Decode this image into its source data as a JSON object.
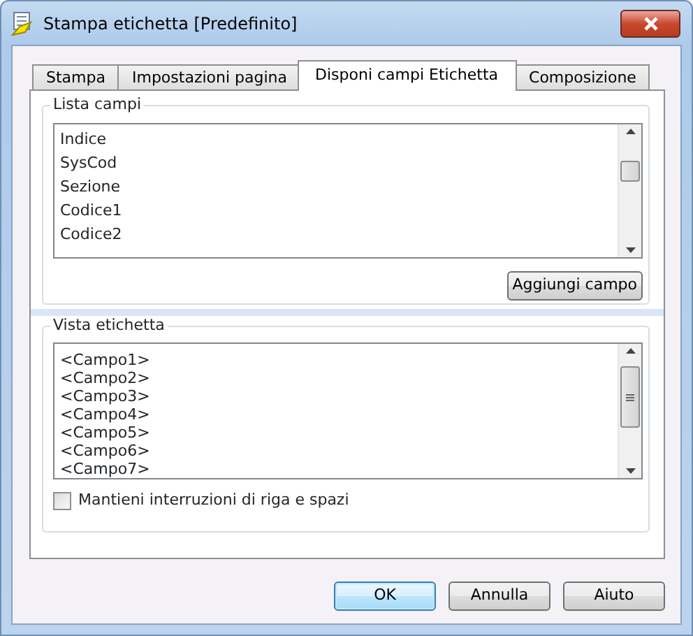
{
  "window": {
    "title": "Stampa etichetta [Predefinito]"
  },
  "tabs": [
    {
      "label": "Stampa",
      "selected": false
    },
    {
      "label": "Impostazioni pagina",
      "selected": false
    },
    {
      "label": "Disponi campi Etichetta",
      "selected": true
    },
    {
      "label": "Composizione",
      "selected": false
    }
  ],
  "field_list": {
    "title": "Lista campi",
    "items": [
      "Indice",
      "SysCod",
      "Sezione",
      "Codice1",
      "Codice2"
    ],
    "add_button": "Aggiungi campo"
  },
  "label_view": {
    "title": "Vista etichetta",
    "lines": [
      "<Campo1>",
      "<Campo2>",
      "<Campo3>",
      "<Campo4>",
      "<Campo5>",
      "<Campo6>",
      "<Campo7>"
    ],
    "keep_breaks": {
      "label": "Mantieni interruzioni di riga e spazi",
      "checked": false
    }
  },
  "buttons": [
    {
      "label": "OK",
      "default": true
    },
    {
      "label": "Annulla",
      "default": false
    },
    {
      "label": "Aiuto",
      "default": false
    }
  ]
}
